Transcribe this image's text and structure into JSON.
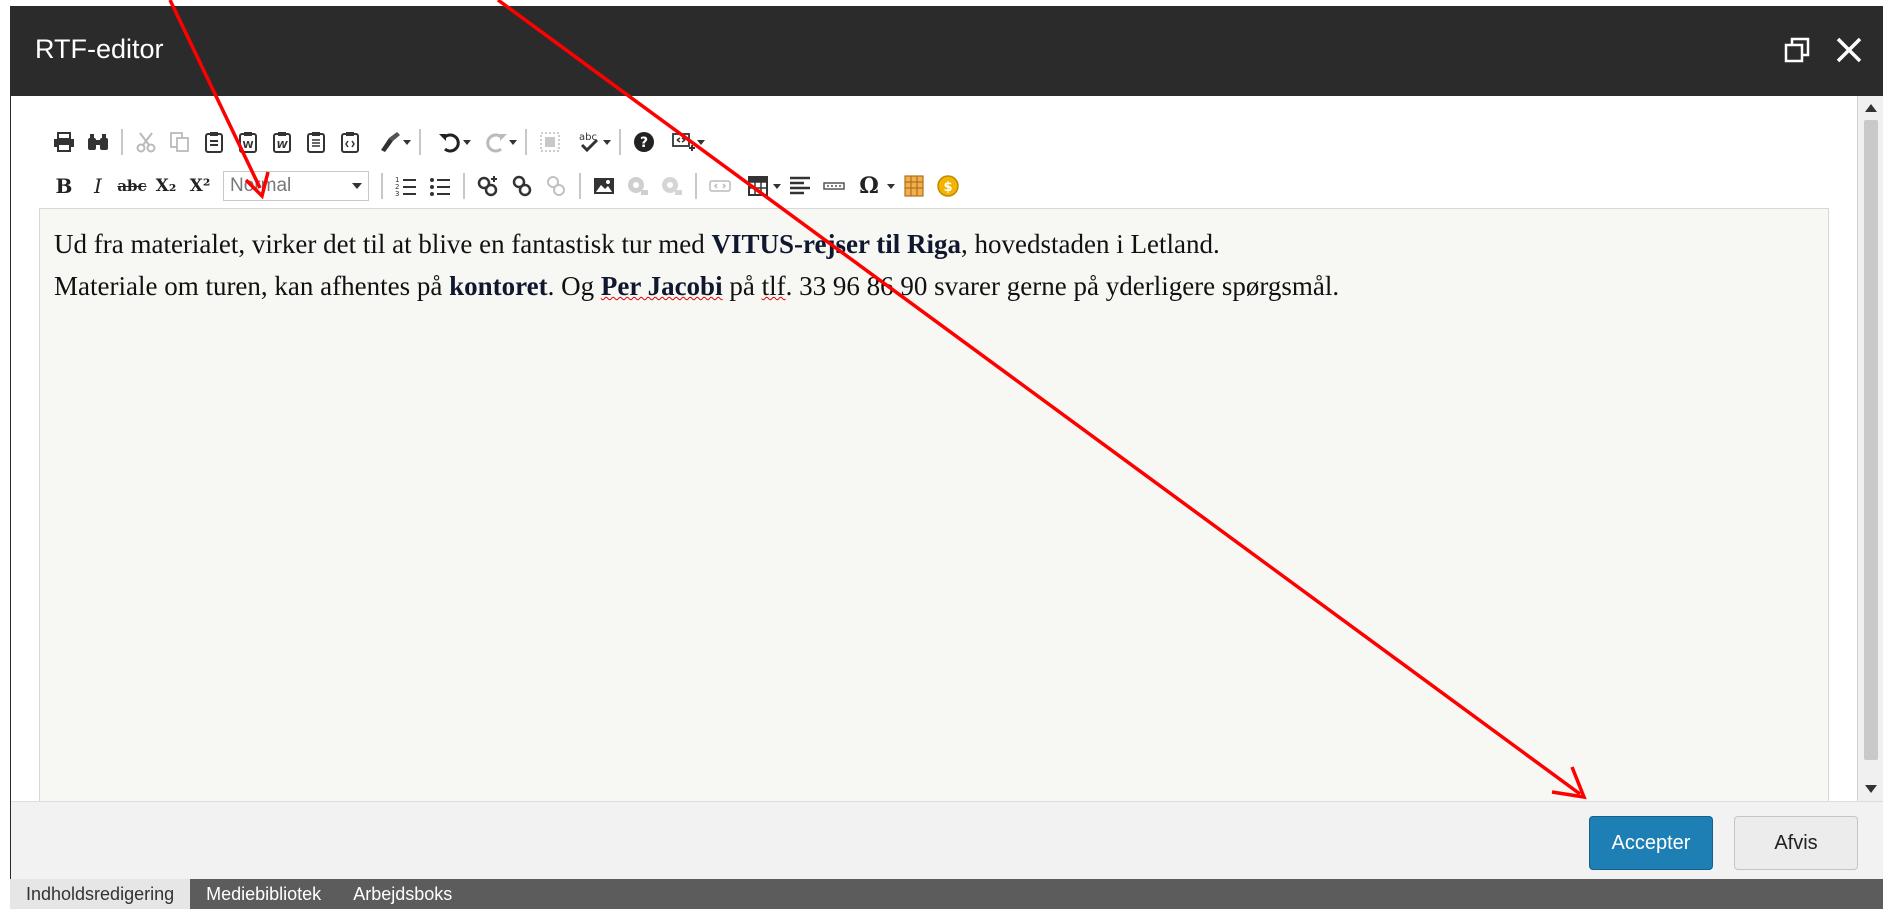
{
  "dialog": {
    "title": "RTF-editor",
    "icons": {
      "restore": "restore-window-icon",
      "close": "close-icon"
    }
  },
  "toolbar": {
    "row1_icons": [
      "print-icon",
      "find-icon",
      "cut-icon",
      "copy-icon",
      "paste-icon",
      "paste-word-icon",
      "paste-word-2-icon",
      "paste-text-icon",
      "paste-special-icon",
      "format-painter-icon",
      "undo-icon",
      "redo-icon",
      "select-all-icon",
      "spellcheck-icon",
      "help-icon",
      "show-blocks-icon"
    ],
    "bold_label": "B",
    "italic_label": "I",
    "strike_label": "abc",
    "subscript_label": "X₂",
    "superscript_label": "X²",
    "format_select_value": "Normal",
    "row2_icons": [
      "ordered-list-icon",
      "bullet-list-icon",
      "link-icon",
      "unlink-icon",
      "anchor-icon",
      "image-icon",
      "media-icon",
      "flash-icon",
      "embed-icon",
      "table-icon",
      "align-icon",
      "horizontal-rule-icon",
      "special-char-icon",
      "template-icon",
      "coin-icon"
    ],
    "special_char_label": "Ω"
  },
  "content": {
    "line1": {
      "t1": "Ud fra materialet, virker det til at blive en fantastisk tur med ",
      "b1": "VITUS-rejser til Riga",
      "t2": ", hovedstaden i Letland."
    },
    "line2": {
      "t1": "Materiale om turen, kan afhentes på ",
      "b1": "kontoret",
      "t2": ". Og ",
      "b2": "Per Jacobi",
      "t3": " på ",
      "spell": "tlf",
      "t4": ". 33 96 86 90 svarer gerne på yderligere spørgsmål."
    }
  },
  "footer": {
    "accept_label": "Accepter",
    "reject_label": "Afvis"
  },
  "tabs": [
    {
      "label": "Indholdsredigering",
      "active": true
    },
    {
      "label": "Mediebibliotek",
      "active": false
    },
    {
      "label": "Arbejdsboks",
      "active": false
    }
  ],
  "colors": {
    "titlebar": "#2b2b2b",
    "accept": "#1e7fb5",
    "annotation": "#ff0000",
    "tabbar": "#5c5c5c"
  }
}
